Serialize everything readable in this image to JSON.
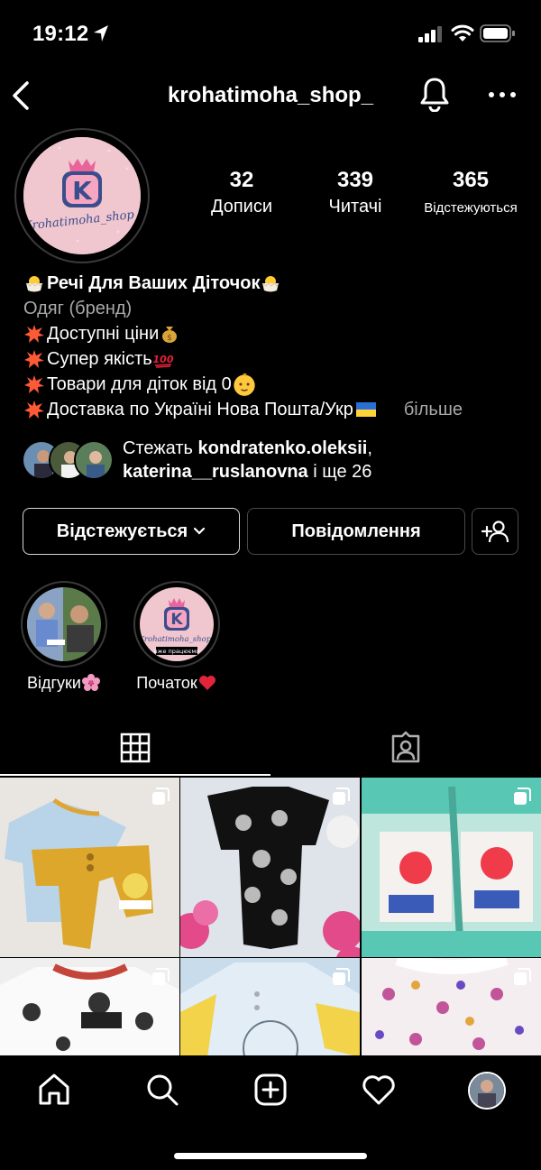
{
  "status_bar": {
    "time": "19:12"
  },
  "header": {
    "username": "krohatimoha_shop_"
  },
  "profile": {
    "logo_text": "Krohatimoha_shop_",
    "logo_letter": "K",
    "stats": [
      {
        "value": "32",
        "label": "Дописи"
      },
      {
        "value": "339",
        "label": "Читачі"
      },
      {
        "value": "365",
        "label": "Відстежуються"
      }
    ]
  },
  "bio": {
    "name": "Речі Для Ваших Діточок",
    "category": "Одяг (бренд)",
    "lines": [
      "Доступні ціни",
      "Супер якість",
      "Товари для діток від 0",
      "Доставка по Україні Нова Пошта/Укр"
    ],
    "more": "більше"
  },
  "followed_by": {
    "prefix": "Стежать ",
    "user1": "kondratenko.oleksii",
    "comma": ",",
    "user2": "katerina__ruslanovna",
    "suffix": " і ще 26"
  },
  "buttons": {
    "following": "Відстежується",
    "message": "Повідомлення"
  },
  "highlights": [
    {
      "label": "Відгуки"
    },
    {
      "label": "Початок",
      "caption": "вже працюємо"
    }
  ],
  "colors": {
    "background": "#000000",
    "text": "#ffffff",
    "muted": "#a8a8a8",
    "logo_pink": "#f0c6cf",
    "logo_blue": "#3b4d8c"
  }
}
